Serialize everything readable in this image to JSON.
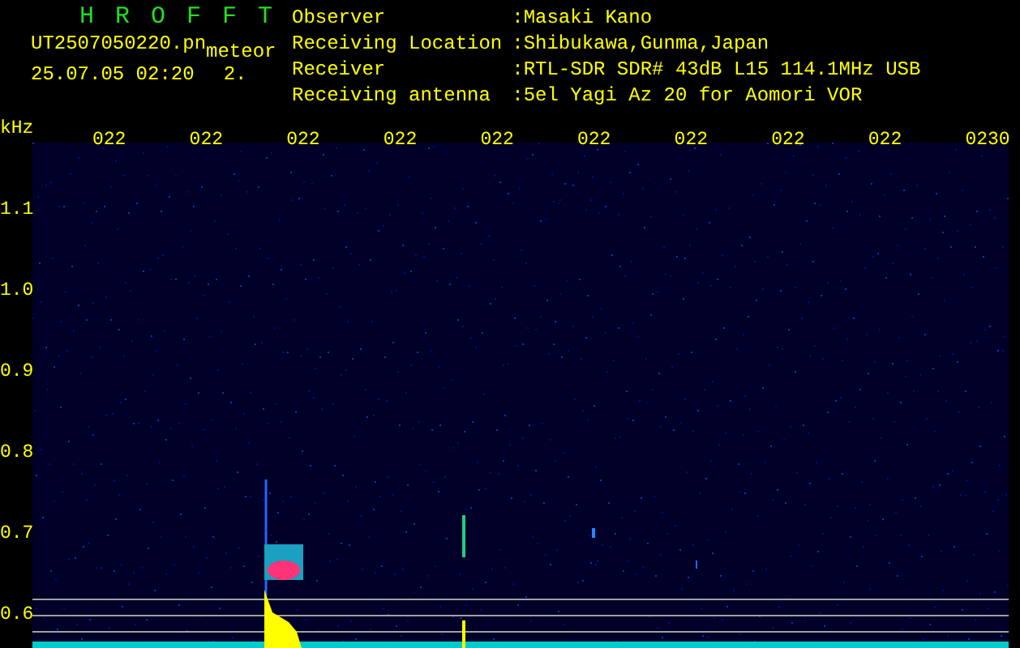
{
  "app_title": "H R O F F T",
  "file_name": "UT2507050220.pn",
  "timestamp": "25.07.05 02:20",
  "detection": {
    "label": "meteor",
    "count": "2."
  },
  "station_info": [
    {
      "label": "Observer",
      "value": ":Masaki Kano"
    },
    {
      "label": "Receiving Location",
      "value": ":Shibukawa,Gunma,Japan"
    },
    {
      "label": "Receiver",
      "value": ":RTL-SDR SDR# 43dB L15 114.1MHz USB"
    },
    {
      "label": "Receiving antenna",
      "value": ":5el Yagi Az 20 for Aomori VOR"
    }
  ],
  "frequency_axis": {
    "unit": "kHz",
    "labels": [
      "1.1",
      "1.0",
      "0.9",
      "0.8",
      "0.7",
      "0.6"
    ]
  },
  "time_axis": {
    "labels": [
      "022",
      "022",
      "022",
      "022",
      "022",
      "022",
      "022",
      "022",
      "022",
      "0230"
    ]
  }
}
